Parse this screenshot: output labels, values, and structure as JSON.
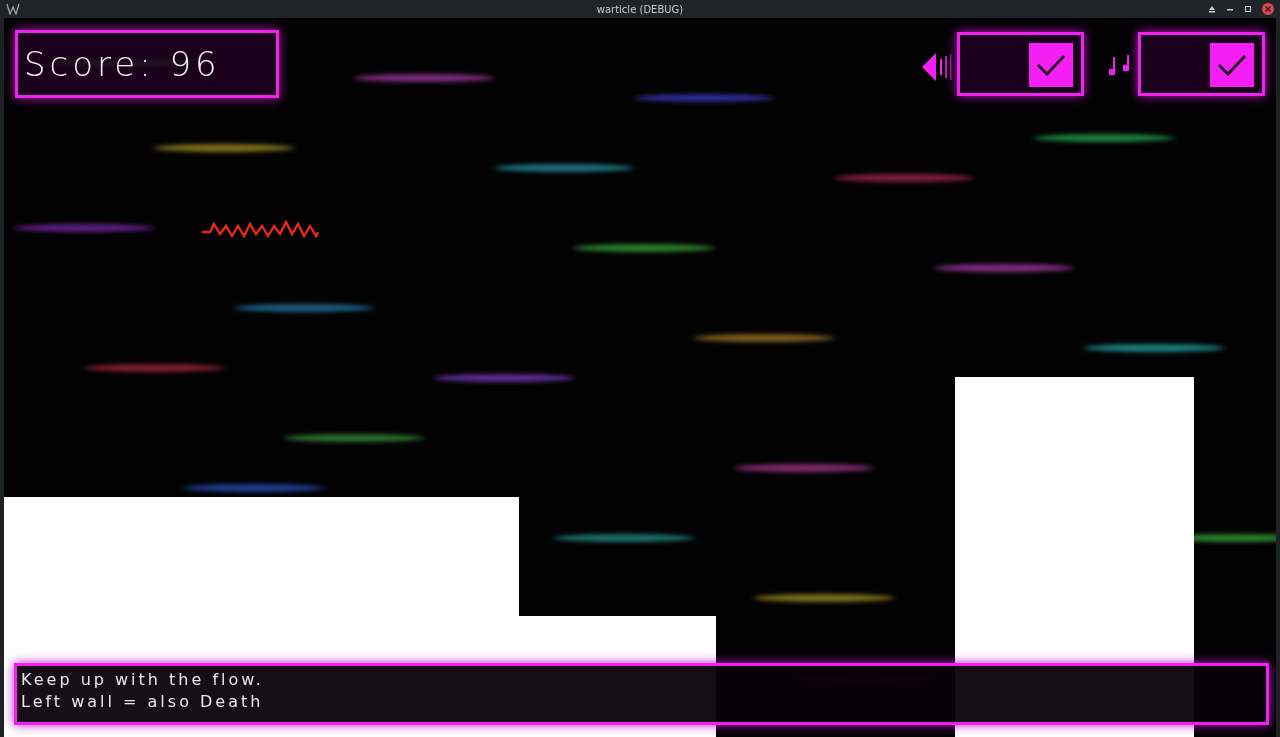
{
  "window": {
    "title": "warticle (DEBUG)"
  },
  "score": {
    "label": "Score: 96"
  },
  "toggles": [
    {
      "kind": "sound",
      "checked": true
    },
    {
      "kind": "music",
      "checked": true
    }
  ],
  "message": {
    "lines": [
      "Keep up with the flow.",
      "Left wall = also Death"
    ]
  }
}
